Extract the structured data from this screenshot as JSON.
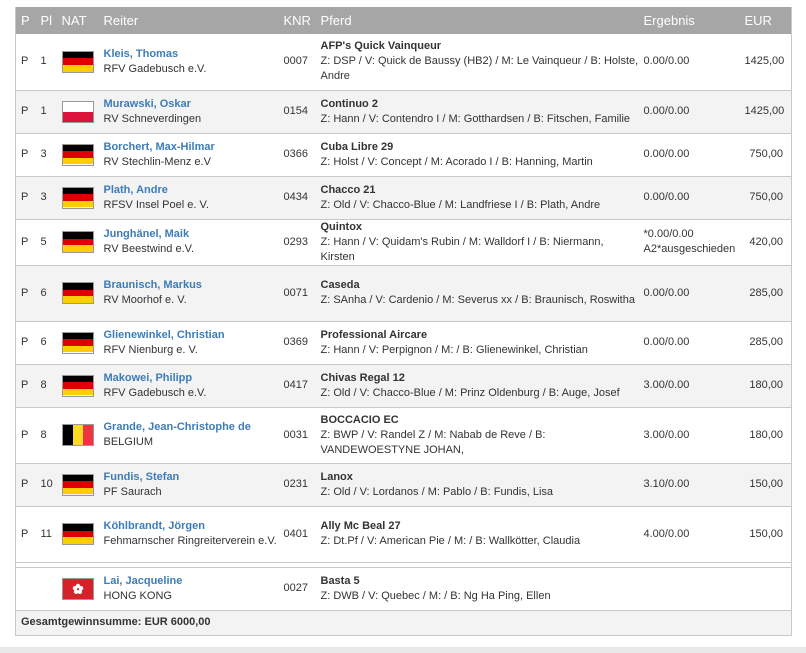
{
  "headers": {
    "p": "P",
    "pl": "Pl",
    "nat": "NAT",
    "reiter": "Reiter",
    "knr": "KNR",
    "pferd": "Pferd",
    "ergebnis": "Ergebnis",
    "eur": "EUR"
  },
  "rows": [
    {
      "p": "P",
      "pl": "1",
      "flag": "de",
      "rider": "Kleis, Thomas",
      "club": "RFV Gadebusch e.V.",
      "knr": "0007",
      "horse": "AFP's Quick Vainqueur",
      "details": "Z: DSP / V: Quick de Baussy (HB2) / M: Le Vainqueur / B: Holste, Andre",
      "result": "0.00/0.00",
      "result2": "",
      "eur": "1425,00"
    },
    {
      "p": "P",
      "pl": "1",
      "flag": "pl",
      "rider": "Murawski, Oskar",
      "club": "RV Schneverdingen",
      "knr": "0154",
      "horse": "Continuo 2",
      "details": "Z: Hann / V: Contendro I / M: Gotthardsen / B: Fitschen, Familie",
      "result": "0.00/0.00",
      "result2": "",
      "eur": "1425,00"
    },
    {
      "p": "P",
      "pl": "3",
      "flag": "de",
      "rider": "Borchert, Max-Hilmar",
      "club": "RV Stechlin-Menz e.V",
      "knr": "0366",
      "horse": "Cuba Libre 29",
      "details": "Z: Holst / V: Concept / M: Acorado I / B: Hanning, Martin",
      "result": "0.00/0.00",
      "result2": "",
      "eur": "750,00"
    },
    {
      "p": "P",
      "pl": "3",
      "flag": "de",
      "rider": "Plath, Andre",
      "club": "RFSV Insel Poel e. V.",
      "knr": "0434",
      "horse": "Chacco 21",
      "details": "Z: Old / V: Chacco-Blue / M: Landfriese I / B: Plath, Andre",
      "result": "0.00/0.00",
      "result2": "",
      "eur": "750,00"
    },
    {
      "p": "P",
      "pl": "5",
      "flag": "de",
      "rider": "Junghänel, Maik",
      "club": "RV Beestwind e.V.",
      "knr": "0293",
      "horse": "Quintox",
      "details": "Z: Hann / V: Quidam's Rubin / M: Walldorf I / B: Niermann, Kirsten",
      "result": "*0.00/0.00",
      "result2": "A2*ausgeschieden",
      "eur": "420,00"
    },
    {
      "p": "P",
      "pl": "6",
      "flag": "de",
      "rider": "Braunisch, Markus",
      "club": "RV Moorhof e. V.",
      "knr": "0071",
      "horse": "Caseda",
      "details": "Z: SAnha / V: Cardenio / M: Severus xx / B: Braunisch, Roswitha",
      "result": "0.00/0.00",
      "result2": "",
      "eur": "285,00"
    },
    {
      "p": "P",
      "pl": "6",
      "flag": "de",
      "rider": "Glienewinkel, Christian",
      "club": "RFV Nienburg e. V.",
      "knr": "0369",
      "horse": "Professional Aircare",
      "details": "Z: Hann / V: Perpignon / M: / B: Glienewinkel, Christian",
      "result": "0.00/0.00",
      "result2": "",
      "eur": "285,00"
    },
    {
      "p": "P",
      "pl": "8",
      "flag": "de",
      "rider": "Makowei, Philipp",
      "club": "RFV Gadebusch e.V.",
      "knr": "0417",
      "horse": "Chivas Regal 12",
      "details": "Z: Old / V: Chacco-Blue / M: Prinz Oldenburg / B: Auge, Josef",
      "result": "3.00/0.00",
      "result2": "",
      "eur": "180,00"
    },
    {
      "p": "P",
      "pl": "8",
      "flag": "be",
      "rider": "Grande, Jean-Christophe de",
      "club": "BELGIUM",
      "knr": "0031",
      "horse": "BOCCACIO EC",
      "details": "Z: BWP / V: Randel Z / M: Nabab de Reve / B: VANDEWOESTYNE JOHAN,",
      "result": "3.00/0.00",
      "result2": "",
      "eur": "180,00"
    },
    {
      "p": "P",
      "pl": "10",
      "flag": "de",
      "rider": "Fundis, Stefan",
      "club": "PF Saurach",
      "knr": "0231",
      "horse": "Lanox",
      "details": "Z: Old / V: Lordanos / M: Pablo / B: Fundis, Lisa",
      "result": "3.10/0.00",
      "result2": "",
      "eur": "150,00"
    },
    {
      "p": "P",
      "pl": "11",
      "flag": "de",
      "rider": "Köhlbrandt, Jörgen",
      "club": "Fehmarnscher Ringreiterverein e.V.",
      "knr": "0401",
      "horse": "Ally Mc Beal 27",
      "details": "Z: Dt.Pf / V: American Pie / M: / B: Wallkötter, Claudia",
      "result": "4.00/0.00",
      "result2": "",
      "eur": "150,00"
    }
  ],
  "extra_row": {
    "p": "",
    "pl": "",
    "flag": "hk",
    "rider": "Lai, Jacqueline",
    "club": "HONG KONG",
    "knr": "0027",
    "horse": "Basta 5",
    "details": "Z: DWB / V: Quebec / M: / B: Ng Ha Ping, Ellen",
    "result": "",
    "result2": "",
    "eur": ""
  },
  "total": "Gesamtgewinnsumme: EUR 6000,00",
  "flag_colors": {
    "de": [
      "#000000",
      "#dd0000",
      "#ffce00"
    ],
    "pl": [
      "#ffffff",
      "#dc143c"
    ],
    "be": [
      "#000000",
      "#fdda24",
      "#ef3340"
    ],
    "hk": [
      "#d8202a",
      "#ffffff"
    ]
  }
}
